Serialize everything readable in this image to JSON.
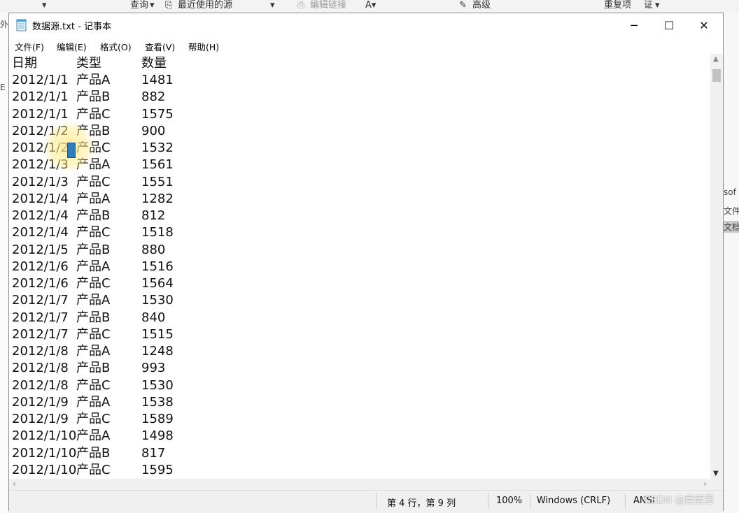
{
  "background": {
    "ribbon": [
      "查询",
      "最近使用的源",
      "编辑链接",
      "高级",
      "重复项",
      "证"
    ],
    "left_glyphs": [
      "外",
      "E"
    ],
    "right_glyphs": [
      "sof",
      "文件",
      "文档"
    ]
  },
  "window": {
    "title": "数据源.txt - 记事本",
    "controls": {
      "minimize": "─",
      "maximize": "☐",
      "close": "✕"
    }
  },
  "menu": [
    "文件(F)",
    "编辑(E)",
    "格式(O)",
    "查看(V)",
    "帮助(H)"
  ],
  "document": {
    "headers": [
      "日期",
      "类型",
      "数量"
    ],
    "rows": [
      [
        "2012/1/1",
        "产品A",
        "1481"
      ],
      [
        "2012/1/1",
        "产品B",
        "882"
      ],
      [
        "2012/1/1",
        "产品C",
        "1575"
      ],
      [
        "2012/1/2",
        "产品B",
        "900"
      ],
      [
        "2012/1/2",
        "产品C",
        "1532"
      ],
      [
        "2012/1/3",
        "产品A",
        "1561"
      ],
      [
        "2012/1/3",
        "产品C",
        "1551"
      ],
      [
        "2012/1/4",
        "产品A",
        "1282"
      ],
      [
        "2012/1/4",
        "产品B",
        "812"
      ],
      [
        "2012/1/4",
        "产品C",
        "1518"
      ],
      [
        "2012/1/5",
        "产品B",
        "880"
      ],
      [
        "2012/1/6",
        "产品A",
        "1516"
      ],
      [
        "2012/1/6",
        "产品C",
        "1564"
      ],
      [
        "2012/1/7",
        "产品A",
        "1530"
      ],
      [
        "2012/1/7",
        "产品B",
        "840"
      ],
      [
        "2012/1/7",
        "产品C",
        "1515"
      ],
      [
        "2012/1/8",
        "产品A",
        "1248"
      ],
      [
        "2012/1/8",
        "产品B",
        "993"
      ],
      [
        "2012/1/8",
        "产品C",
        "1530"
      ],
      [
        "2012/1/9",
        "产品A",
        "1538"
      ],
      [
        "2012/1/9",
        "产品C",
        "1589"
      ],
      [
        "2012/1/10",
        "产品A",
        "1498"
      ],
      [
        "2012/1/10",
        "产品B",
        "817"
      ],
      [
        "2012/1/10",
        "产品C",
        "1595"
      ]
    ]
  },
  "status": {
    "position": "第 4 行，第 9 列",
    "zoom": "100%",
    "line_ending": "Windows (CRLF)",
    "encoding": "ANSI"
  },
  "watermark": "CSDN @唐唐思"
}
